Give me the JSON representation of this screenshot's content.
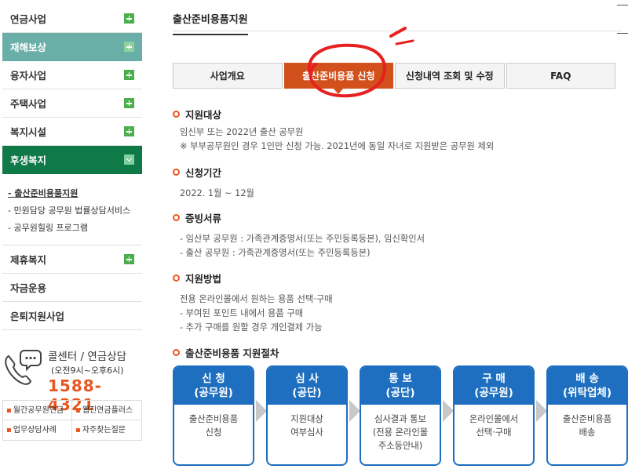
{
  "sidebar": {
    "items_top": [
      {
        "label": "연금사업"
      },
      {
        "label": "재해보상"
      },
      {
        "label": "융자사업"
      },
      {
        "label": "주택사업"
      },
      {
        "label": "복지시설"
      },
      {
        "label": "후생복지"
      }
    ],
    "submenu": [
      {
        "label": "- 출산준비용품지원"
      },
      {
        "label": "- 민원담당 공무원 법률상담서비스"
      },
      {
        "label": "- 공무원힐링 프로그램"
      }
    ],
    "items_bottom": [
      {
        "label": "제휴복지"
      },
      {
        "label": "자금운용"
      },
      {
        "label": "은퇴지원사업"
      }
    ]
  },
  "callcenter": {
    "title": "콜센터 / 연금상담",
    "hours": "(오전9시~오후6시)",
    "number": "1588-4321"
  },
  "quicklinks": [
    {
      "label": "월간공무원연금"
    },
    {
      "label": "웹진연금플러스"
    },
    {
      "label": "업무상담사례"
    },
    {
      "label": "자주찾는질문"
    }
  ],
  "main": {
    "page_title": "출산준비용품지원",
    "tabs": [
      {
        "label": "사업개요"
      },
      {
        "label": "출산준비용품 신청"
      },
      {
        "label": "신청내역 조회 및 수정"
      },
      {
        "label": "FAQ"
      }
    ],
    "sections": [
      {
        "title": "지원대상",
        "lines": [
          "임신부 또는 2022년 출산 공무원",
          "※ 부부공무원인 경우 1인만 신청 가능. 2021년에 동일 자녀로 지원받은 공무원 제외"
        ]
      },
      {
        "title": "신청기간",
        "lines": [
          "2022. 1월 ~ 12월"
        ]
      },
      {
        "title": "증빙서류",
        "lines": [
          "- 임산부 공무원 : 가족관계증명서(또는 주민등록등본), 임신확인서",
          "- 출산 공무원 : 가족관계증명서(또는 주민등록등본)"
        ]
      },
      {
        "title": "지원방법",
        "lines": [
          "전용 온라인몰에서 원하는 용품 선택·구매",
          "- 부여된 포인트 내에서 용품 구매",
          "- 추가 구매를 원할 경우 개인결제 가능"
        ]
      },
      {
        "title": "출산준비용품 지원절차",
        "lines": []
      }
    ],
    "steps": [
      {
        "head1": "신 청",
        "head2": "(공무원)",
        "body": [
          "출산준비용품",
          "신청"
        ]
      },
      {
        "head1": "심 사",
        "head2": "(공단)",
        "body": [
          "지원대상",
          "여부심사"
        ]
      },
      {
        "head1": "통 보",
        "head2": "(공단)",
        "body": [
          "심사결과 통보",
          "(전용 온라인몰",
          "주소등안내)"
        ]
      },
      {
        "head1": "구 매",
        "head2": "(공무원)",
        "body": [
          "온라인몰에서",
          "선택·구매"
        ]
      },
      {
        "head1": "배 송",
        "head2": "(위탁업체)",
        "body": [
          "출산준비용품",
          "배송"
        ]
      }
    ]
  },
  "colors": {
    "accent": "#d2501b",
    "teal": "#6aafa7",
    "green": "#0f7a47",
    "blue": "#1e6fbf",
    "orange": "#e8561f"
  }
}
